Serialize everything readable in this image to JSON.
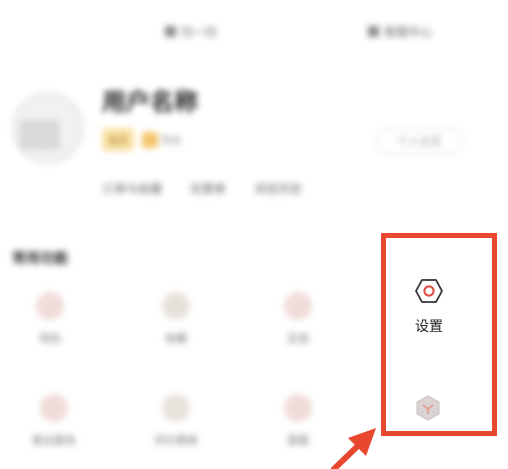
{
  "topbar": {
    "left_label": "扫一扫",
    "right_label": "客服中心"
  },
  "profile": {
    "username": "用户名称",
    "badge_primary": "会员",
    "badge_secondary": "等级",
    "edit_button": "个人主页",
    "stats": [
      "订单与收藏",
      "优惠券",
      "浏览历史"
    ]
  },
  "services": {
    "title": "常用功能",
    "row1": [
      "钱包",
      "收藏",
      "足迹"
    ],
    "row2": [
      "售后服务",
      "评价晒单",
      "客服"
    ],
    "highlight": {
      "label": "设置",
      "color": "#e8482f"
    }
  },
  "colors": {
    "accent": "#e8482f",
    "icon_red": "#e04a3f"
  }
}
